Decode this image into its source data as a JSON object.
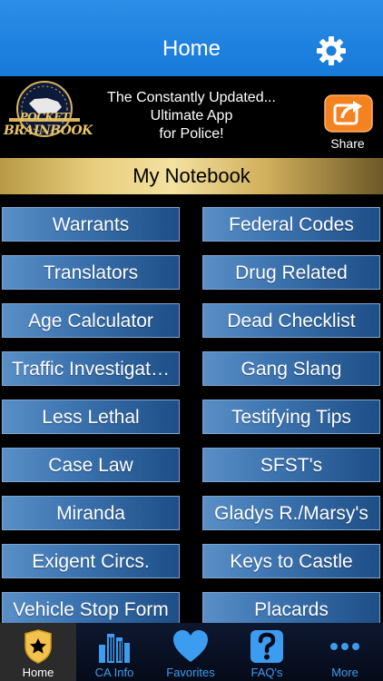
{
  "nav": {
    "title": "Home"
  },
  "banner": {
    "logo_line1": "POCKET",
    "logo_line2": "BRAINBOOK",
    "line1": "The Constantly Updated...",
    "line2": "Ultimate App",
    "line3": "for Police!",
    "share_label": "Share"
  },
  "section": {
    "title": "My Notebook"
  },
  "grid": {
    "left": [
      "Warrants",
      "Translators",
      "Age Calculator",
      "Traffic Investigat…",
      "Less Lethal",
      "Case Law",
      "Miranda",
      "Exigent Circs.",
      "Vehicle Stop Form"
    ],
    "right": [
      "Federal Codes",
      "Drug Related",
      "Dead Checklist",
      "Gang Slang",
      "Testifying Tips",
      "SFST's",
      "Gladys R./Marsy's",
      "Keys to Castle",
      "Placards"
    ]
  },
  "tabs": [
    {
      "label": "Home",
      "icon": "badge-icon"
    },
    {
      "label": "CA Info",
      "icon": "buildings-icon"
    },
    {
      "label": "Favorites",
      "icon": "heart-icon"
    },
    {
      "label": "FAQ's",
      "icon": "question-icon"
    },
    {
      "label": "More",
      "icon": "more-icon"
    }
  ],
  "colors": {
    "nav_blue": "#1f82dd",
    "button_blue": "#3d74b0",
    "gold": "#e8ce7e",
    "share_orange": "#f58220",
    "tab_blue": "#3c9cf0"
  }
}
